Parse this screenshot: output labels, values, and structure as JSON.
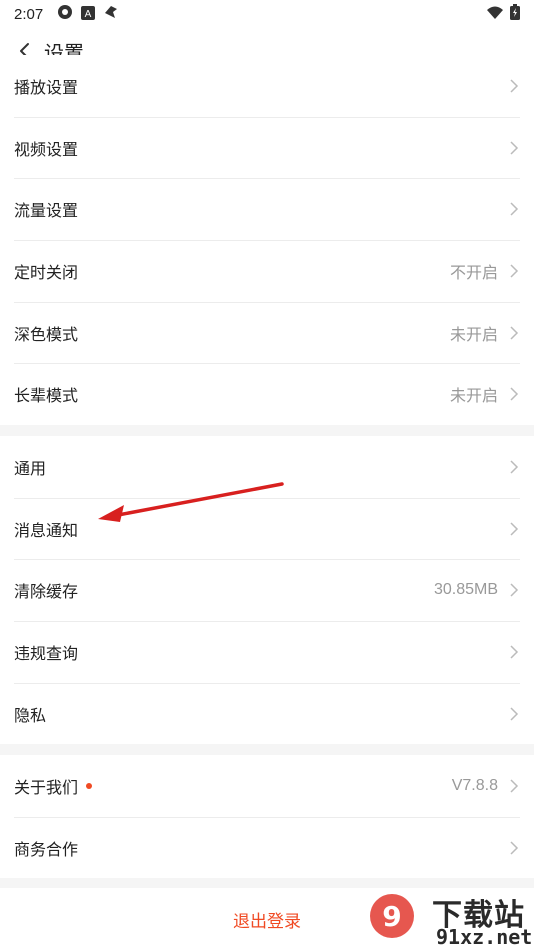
{
  "status_bar": {
    "time": "2:07"
  },
  "header": {
    "title": "设置"
  },
  "group1": [
    {
      "label": "播放设置",
      "value": ""
    },
    {
      "label": "视频设置",
      "value": ""
    },
    {
      "label": "流量设置",
      "value": ""
    },
    {
      "label": "定时关闭",
      "value": "不开启"
    },
    {
      "label": "深色模式",
      "value": "未开启"
    },
    {
      "label": "长辈模式",
      "value": "未开启"
    }
  ],
  "group2": [
    {
      "label": "通用",
      "value": ""
    },
    {
      "label": "消息通知",
      "value": ""
    },
    {
      "label": "清除缓存",
      "value": "30.85MB"
    },
    {
      "label": "违规查询",
      "value": ""
    },
    {
      "label": "隐私",
      "value": ""
    }
  ],
  "group3": [
    {
      "label": "关于我们",
      "value": "V7.8.8"
    },
    {
      "label": "商务合作",
      "value": ""
    }
  ],
  "logout": {
    "label": "退出登录"
  },
  "watermark": {
    "cn": "下载站",
    "en": "91xz.net"
  },
  "colors": {
    "accent": "#f04a23",
    "annotation_arrow": "#d8201f",
    "background": "#f5f5f5"
  }
}
